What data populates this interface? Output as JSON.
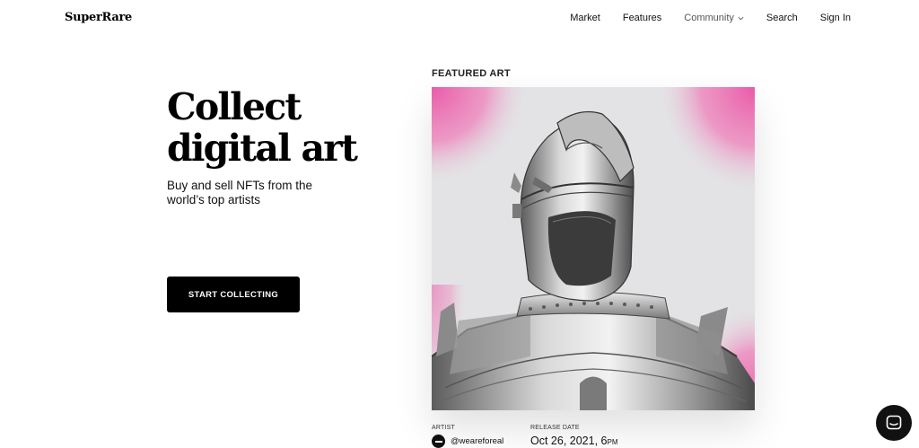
{
  "header": {
    "logo": "SuperRare",
    "nav": [
      "Market",
      "Features",
      "Community",
      "Search",
      "Sign In"
    ]
  },
  "hero": {
    "title_line1": "Collect",
    "title_line2": "digital art",
    "subtitle_line1": "Buy and sell NFTs from the",
    "subtitle_line2": "world’s top artists",
    "cta_label": "START COLLECTING"
  },
  "featured": {
    "section_label": "FEATURED ART",
    "artist_label": "ARTIST",
    "artist_handle": "@weareforeal",
    "release_label": "RELEASE DATE",
    "release_date": "Oct 26, 2021, 6",
    "release_time_suffix": "PM",
    "accent_color": "#ea5aa8"
  },
  "icons": {
    "community_caret": "chevron-down-icon",
    "chat": "chat-icon"
  }
}
